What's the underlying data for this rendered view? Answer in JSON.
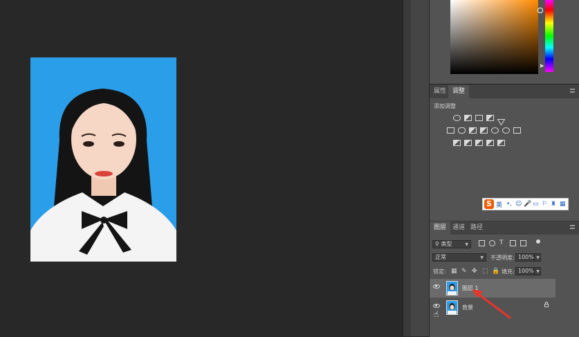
{
  "adjustments_panel": {
    "tabs": [
      {
        "label": "属性",
        "active": false
      },
      {
        "label": "调整",
        "active": true
      }
    ],
    "title": "添加调整",
    "icon_rows": [
      [
        "brightness-contrast-icon",
        "levels-icon",
        "curves-icon",
        "exposure-icon",
        "gradient-triangle-icon"
      ],
      [
        "vibrance-icon",
        "hue-saturation-icon",
        "color-balance-icon",
        "black-white-icon",
        "photo-filter-icon",
        "channel-mixer-icon",
        "color-lookup-icon"
      ],
      [
        "invert-icon",
        "posterize-icon",
        "threshold-icon",
        "gradient-map-icon",
        "selective-color-icon"
      ]
    ]
  },
  "ime_toolbar": {
    "logo": "S",
    "language": "英",
    "glyphs": [
      "•,",
      "☺",
      "🎤",
      "▭",
      "⚐",
      "♜",
      "▦"
    ]
  },
  "layers_panel": {
    "tabs": [
      {
        "label": "图层",
        "active": true
      },
      {
        "label": "通道",
        "active": false
      },
      {
        "label": "路径",
        "active": false
      }
    ],
    "filter_kind": "类型",
    "blend_mode": "正常",
    "opacity_label": "不透明度:",
    "opacity_value": "100%",
    "lock_label": "锁定:",
    "fill_label": "填充:",
    "fill_value": "100%",
    "layers": [
      {
        "name": "图层 1",
        "selected": true,
        "locked": false,
        "visible": true
      },
      {
        "name": "背景",
        "selected": false,
        "locked": true,
        "visible": true
      }
    ]
  },
  "colors": {
    "photo_background": "#2b9ee9",
    "panel_background": "#535353",
    "canvas_background": "#282828",
    "annotation_arrow": "#e8352a"
  }
}
